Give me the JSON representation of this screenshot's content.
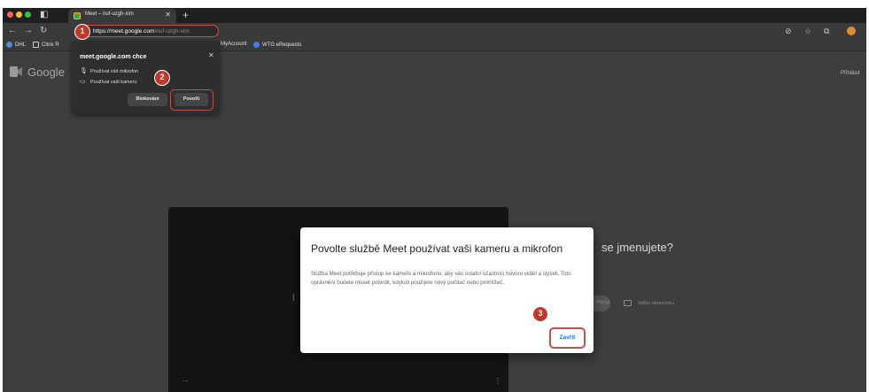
{
  "tab": {
    "title": "Meet – nuf-uzgh-xim"
  },
  "address_bar": {
    "host": "https://meet.google.com",
    "path": "/nuf-uzgh-xim"
  },
  "bookmarks": [
    {
      "label": "DHL"
    },
    {
      "label": "Citrix R"
    },
    {
      "label": "MyAccount"
    },
    {
      "label": "WTG eRequests"
    }
  ],
  "meet": {
    "logo_text": "Google",
    "signin_label": "Přihlásit",
    "join_title": "se jmenujete?",
    "join_ghost_label": "Připojit",
    "present_label": "Sdílet obrazovku",
    "preview_more": "...",
    "preview_kebab": "⋮"
  },
  "permission_popup": {
    "title": "meet.google.com chce",
    "mic_label": "Používat váš mikrofon",
    "camera_label": "Používat vaši kameru",
    "block_label": "Blokování",
    "allow_label": "Povolit"
  },
  "markers": {
    "one": "1",
    "two": "2",
    "three": "3"
  },
  "dialog": {
    "title": "Povolte službě Meet používat vaši kameru a mikrofon",
    "body": "Služba Meet potřebuje přístup ke kameře a mikrofonu, aby vás ostatní účastníci hovoru viděli a slyšeli. Toto oprávnění budete muset potvrdit, kdykoli použijete nový počítač nebo prohlížeč.",
    "close_label": "Zavřít"
  },
  "colors": {
    "marker_red": "#c0392b",
    "highlight_border": "#c0504d",
    "link_blue": "#1a73e8"
  }
}
